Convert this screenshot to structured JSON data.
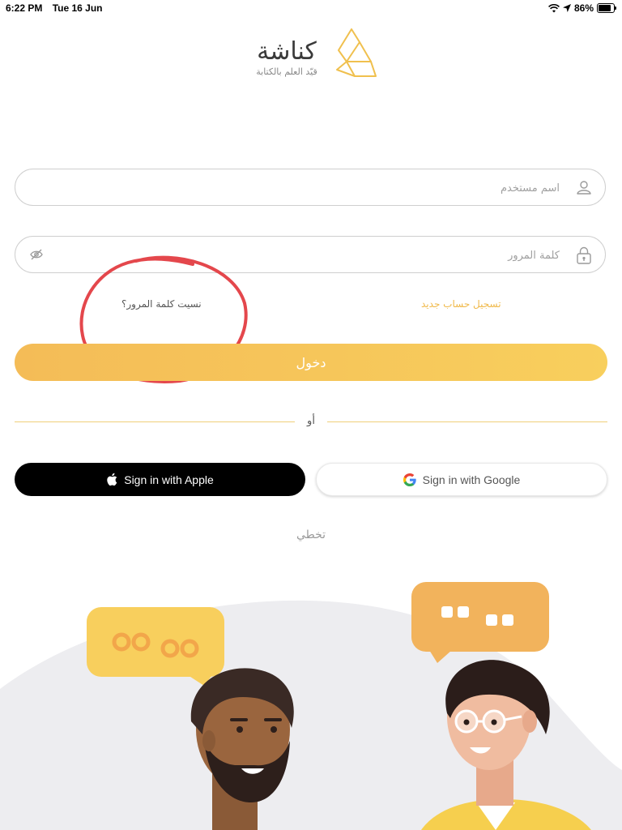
{
  "status_bar": {
    "time": "6:22 PM",
    "date": "Tue 16 Jun",
    "battery": "86%",
    "icons": [
      "wifi-icon",
      "location-arrow-icon",
      "battery-icon"
    ]
  },
  "logo": {
    "name": "كناشة",
    "tagline": "قيّد العلم بالكتابة",
    "mark_icon": "book-mark-icon"
  },
  "form": {
    "username": {
      "placeholder": "اسم مستخدم",
      "value": "",
      "icon": "user-icon"
    },
    "password": {
      "placeholder": "كلمة المرور",
      "value": "",
      "icon": "lock-icon",
      "toggle_icon": "eye-slash-icon"
    },
    "forgot_password": "نسيت كلمة المرور؟",
    "register": "تسجيل حساب جديد",
    "login": "دخول"
  },
  "divider": {
    "text": "أو"
  },
  "social": {
    "apple": "Sign in with Apple",
    "google": "Sign in with Google"
  },
  "skip": "تخطي",
  "colors": {
    "accent": "#f4bc57",
    "accent_light": "#f8cf5d",
    "annotation": "#e4474c",
    "bubble_left": "#f8cf5d",
    "bubble_right": "#f2b35c"
  }
}
